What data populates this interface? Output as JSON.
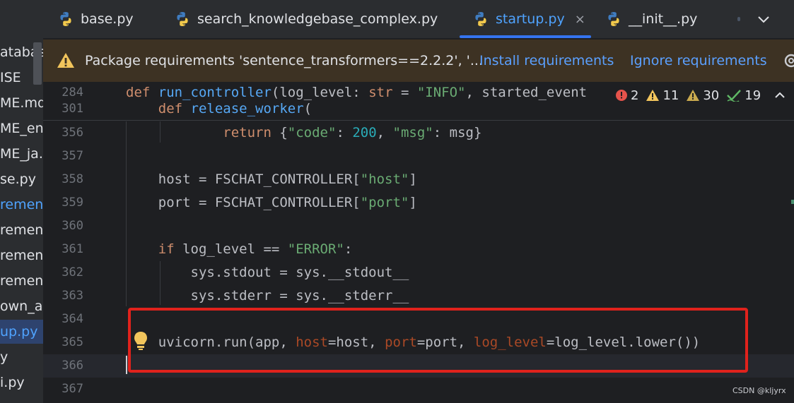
{
  "sidebar": {
    "items": [
      {
        "label": "atabas",
        "state": "normal"
      },
      {
        "label": "ISE",
        "state": "normal"
      },
      {
        "label": "ME.md",
        "state": "normal"
      },
      {
        "label": "ME_en",
        "state": "normal"
      },
      {
        "label": "ME_ja.r",
        "state": "normal"
      },
      {
        "label": "se.py",
        "state": "normal"
      },
      {
        "label": "rement",
        "state": "active"
      },
      {
        "label": "rement",
        "state": "normal"
      },
      {
        "label": "rement",
        "state": "normal"
      },
      {
        "label": "rement",
        "state": "normal"
      },
      {
        "label": "own_a",
        "state": "normal"
      },
      {
        "label": "up.py",
        "state": "selected"
      },
      {
        "label": "y",
        "state": "normal"
      },
      {
        "label": "i.py",
        "state": "normal"
      }
    ]
  },
  "tabs": [
    {
      "label": "base.py",
      "active": false
    },
    {
      "label": "search_knowledgebase_complex.py",
      "active": false
    },
    {
      "label": "startup.py",
      "active": true,
      "close": "×"
    },
    {
      "label": "__init__.py",
      "active": false
    }
  ],
  "banner": {
    "message": "Package requirements 'sentence_transformers==2.2.2', '...",
    "install_label": "Install requirements",
    "ignore_label": "Ignore requirements"
  },
  "inspections": {
    "errors": "2",
    "warnings": "11",
    "weak_warnings": "30",
    "typos": "19",
    "error_color": "#e5534b",
    "warning_color": "#f2c55c",
    "weak_color": "#c9a94e",
    "typo_color": "#5fb865"
  },
  "editor": {
    "sticky": [
      {
        "ln": "284",
        "code": [
          {
            "t": "def ",
            "c": "kw"
          },
          {
            "t": "run_controller",
            "c": "fn"
          },
          {
            "t": "(log_level: ",
            "c": ""
          },
          {
            "t": "str",
            "c": "kw"
          },
          {
            "t": " = ",
            "c": ""
          },
          {
            "t": "\"INFO\"",
            "c": "str"
          },
          {
            "t": ", started_event",
            "c": ""
          }
        ]
      },
      {
        "ln": "301",
        "code": [
          {
            "t": "    def ",
            "c": "kw"
          },
          {
            "t": "release_worker",
            "c": "fn"
          },
          {
            "t": "(",
            "c": ""
          }
        ]
      }
    ],
    "lines": [
      {
        "ln": "356",
        "code": [
          {
            "t": "            return ",
            "c": "kw"
          },
          {
            "t": "{",
            "c": ""
          },
          {
            "t": "\"code\"",
            "c": "str"
          },
          {
            "t": ": ",
            "c": ""
          },
          {
            "t": "200",
            "c": "num"
          },
          {
            "t": ", ",
            "c": ""
          },
          {
            "t": "\"msg\"",
            "c": "str"
          },
          {
            "t": ": msg}",
            "c": ""
          }
        ]
      },
      {
        "ln": "357",
        "code": []
      },
      {
        "ln": "358",
        "code": [
          {
            "t": "    host = FSCHAT_CONTROLLER[",
            "c": ""
          },
          {
            "t": "\"host\"",
            "c": "str"
          },
          {
            "t": "]",
            "c": ""
          }
        ]
      },
      {
        "ln": "359",
        "code": [
          {
            "t": "    port = FSCHAT_CONTROLLER[",
            "c": ""
          },
          {
            "t": "\"port\"",
            "c": "str"
          },
          {
            "t": "]",
            "c": ""
          }
        ]
      },
      {
        "ln": "360",
        "code": []
      },
      {
        "ln": "361",
        "code": [
          {
            "t": "    if ",
            "c": "kw"
          },
          {
            "t": "log_level == ",
            "c": ""
          },
          {
            "t": "\"ERROR\"",
            "c": "str"
          },
          {
            "t": ":",
            "c": ""
          }
        ]
      },
      {
        "ln": "362",
        "code": [
          {
            "t": "        sys.stdout = sys.__stdout__",
            "c": ""
          }
        ]
      },
      {
        "ln": "363",
        "code": [
          {
            "t": "        sys.stderr = sys.__stderr__",
            "c": ""
          }
        ]
      },
      {
        "ln": "364",
        "code": []
      },
      {
        "ln": "365",
        "code": [
          {
            "t": "    uvicorn.run(app, ",
            "c": ""
          },
          {
            "t": "host",
            "c": "param"
          },
          {
            "t": "=host, ",
            "c": ""
          },
          {
            "t": "port",
            "c": "param"
          },
          {
            "t": "=port, ",
            "c": ""
          },
          {
            "t": "log_level",
            "c": "param"
          },
          {
            "t": "=log_level.lower())",
            "c": ""
          }
        ]
      },
      {
        "ln": "366",
        "code": [],
        "current": true
      },
      {
        "ln": "367",
        "code": []
      }
    ]
  },
  "watermark": "CSDN @kljyrx",
  "highlight_color": "#e0221c"
}
